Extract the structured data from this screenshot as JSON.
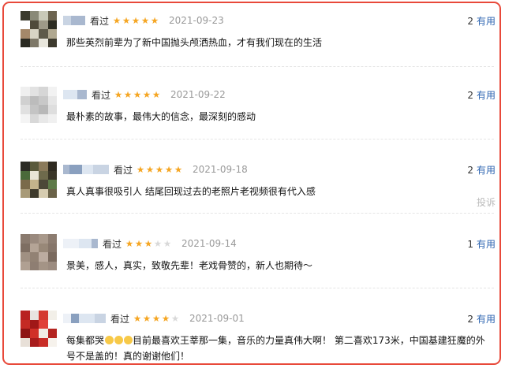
{
  "reviews": [
    {
      "status": "看过",
      "rating": 5,
      "date": "2021-09-23",
      "useful_count": "2",
      "useful_label": "有用",
      "text": "那些英烈前辈为了新中国抛头颅洒热血，才有我们现在的生活"
    },
    {
      "status": "看过",
      "rating": 5,
      "date": "2021-09-22",
      "useful_count": "2",
      "useful_label": "有用",
      "text": "最朴素的故事，最伟大的信念，最深刻的感动"
    },
    {
      "status": "看过",
      "rating": 5,
      "date": "2021-09-18",
      "useful_count": "2",
      "useful_label": "有用",
      "text": "真人真事很吸引人 结尾回现过去的老照片老视频很有代入感"
    },
    {
      "status": "看过",
      "rating": 3,
      "date": "2021-09-14",
      "useful_count": "1",
      "useful_label": "有用",
      "text": "景美，感人，真实，致敬先辈！老戏骨赞的，新人也期待～"
    },
    {
      "status": "看过",
      "rating": 4,
      "date": "2021-09-01",
      "useful_count": "2",
      "useful_label": "有用",
      "text_prefix": "每集都哭",
      "text": "目前最喜欢王莘那一集，音乐的力量真伟大啊！ 第二喜欢173米，中国基建狂魔的外号不是盖的！真的谢谢他们！",
      "emoji": [
        "grin-sweat-emoji",
        "grin-sweat-emoji",
        "grin-sweat-emoji"
      ]
    }
  ],
  "report_label": "投诉",
  "colors": {
    "frame": "#e8493a",
    "star": "#f5a623",
    "star_off": "#d9d9d9",
    "useful_link": "#2f66b2",
    "date": "#999999"
  },
  "icons": [
    "star-icon",
    "blurred-avatar",
    "blurred-username"
  ]
}
